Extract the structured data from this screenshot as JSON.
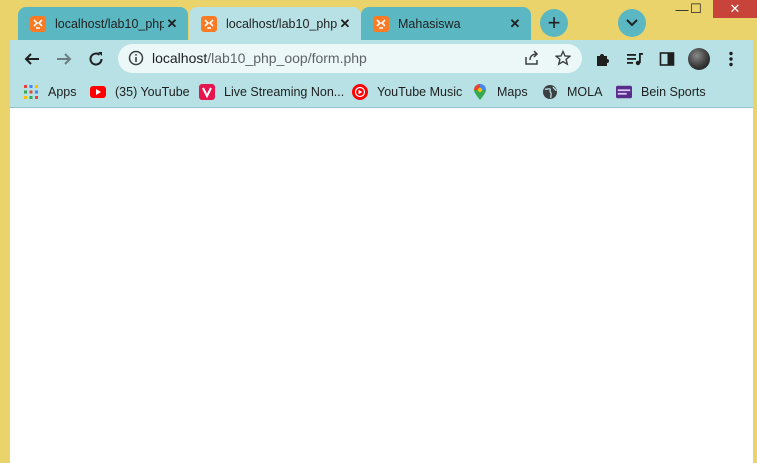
{
  "tabs": [
    {
      "title": "localhost/lab10_php",
      "favicon": "xampp-icon",
      "state": "inactive"
    },
    {
      "title": "localhost/lab10_php",
      "favicon": "xampp-icon",
      "state": "active"
    },
    {
      "title": "Mahasiswa",
      "favicon": "xampp-icon",
      "state": "inactive"
    }
  ],
  "new_tab_label": "+",
  "window_controls": {
    "minimize": "—",
    "maximize": "☐",
    "close": "✕"
  },
  "address_bar": {
    "host": "localhost",
    "path": "/lab10_php_oop/form.php"
  },
  "bookmarks": [
    {
      "label": "Apps",
      "icon": "apps-grid-icon"
    },
    {
      "label": "(35) YouTube",
      "icon": "youtube-icon"
    },
    {
      "label": "Live Streaming Non...",
      "icon": "vidio-icon"
    },
    {
      "label": "YouTube Music",
      "icon": "youtube-music-icon"
    },
    {
      "label": "Maps",
      "icon": "maps-pin-icon"
    },
    {
      "label": "MOLA",
      "icon": "globe-icon"
    },
    {
      "label": "Bein Sports",
      "icon": "bein-icon"
    }
  ],
  "colors": {
    "frame": "#e9d36a",
    "active_tab": "#b7e1e5",
    "inactive_tab": "#5bb8c2",
    "toolbar": "#b7e1e5",
    "omnibox": "#ecf7f8",
    "xampp_orange": "#fb7a24",
    "close_red": "#c8443a"
  }
}
